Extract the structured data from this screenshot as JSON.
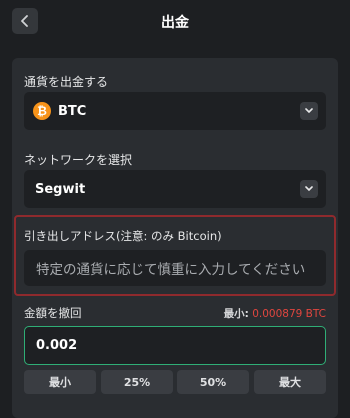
{
  "header": {
    "title": "出金"
  },
  "currency": {
    "label": "通貨を出金する",
    "selected": "BTC"
  },
  "network": {
    "label": "ネットワークを選択",
    "selected": "Segwit"
  },
  "address": {
    "label": "引き出しアドレス(注意: のみ Bitcoin)",
    "placeholder": "特定の通貨に応じて慎重に入力してください"
  },
  "amount": {
    "label": "金額を撤回",
    "min_label": "最小:",
    "min_value": "0.000879 BTC",
    "value": "0.002",
    "buttons": [
      "最小",
      "25%",
      "50%",
      "最大"
    ]
  },
  "colors": {
    "accent": "#2fae76",
    "error": "#e0463f",
    "btc": "#f7931a"
  }
}
